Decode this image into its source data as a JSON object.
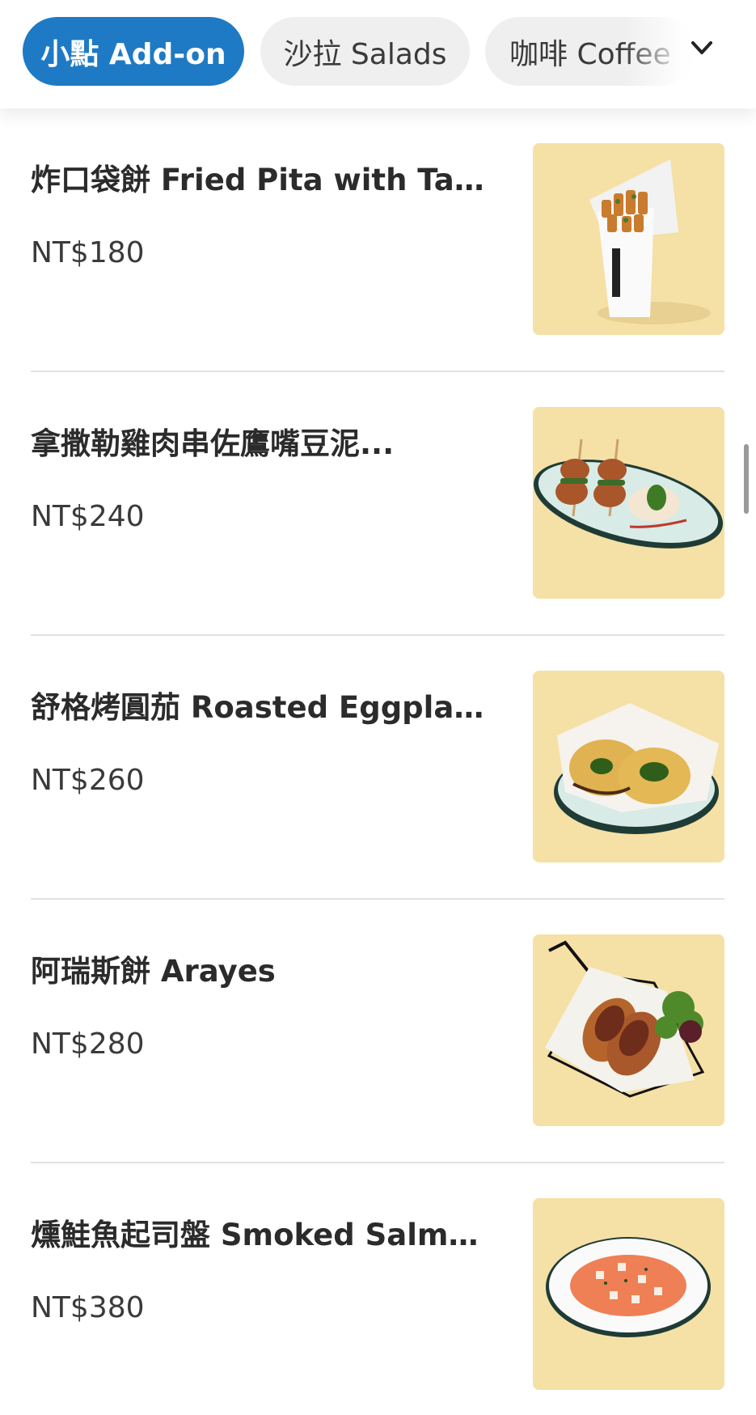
{
  "categories": {
    "tabs": [
      {
        "label": "小點 Add-on",
        "active": true
      },
      {
        "label": "沙拉 Salads",
        "active": false
      },
      {
        "label": "咖啡 Coffee",
        "active": false
      }
    ],
    "expand_icon": "chevron-down-icon"
  },
  "menu": {
    "items": [
      {
        "name": "炸口袋餅 Fried Pita with Tahini",
        "price": "NT$180",
        "image": "fried-pita-photo"
      },
      {
        "name": "拿撒勒雞肉串佐鷹嘴豆泥...",
        "price": "NT$240",
        "image": "chicken-skewer-photo"
      },
      {
        "name": "舒格烤圓茄 Roasted Eggplant...",
        "price": "NT$260",
        "image": "roasted-eggplant-photo"
      },
      {
        "name": "阿瑞斯餅 Arayes",
        "price": "NT$280",
        "image": "arayes-photo"
      },
      {
        "name": "燻鮭魚起司盤 Smoked Salmo...",
        "price": "NT$380",
        "image": "smoked-salmon-photo"
      }
    ]
  },
  "colors": {
    "accent": "#1e7ac4",
    "tab_inactive_bg": "#efefef",
    "thumb_bg": "#f7e3ab",
    "divider": "#e2e2e2"
  }
}
